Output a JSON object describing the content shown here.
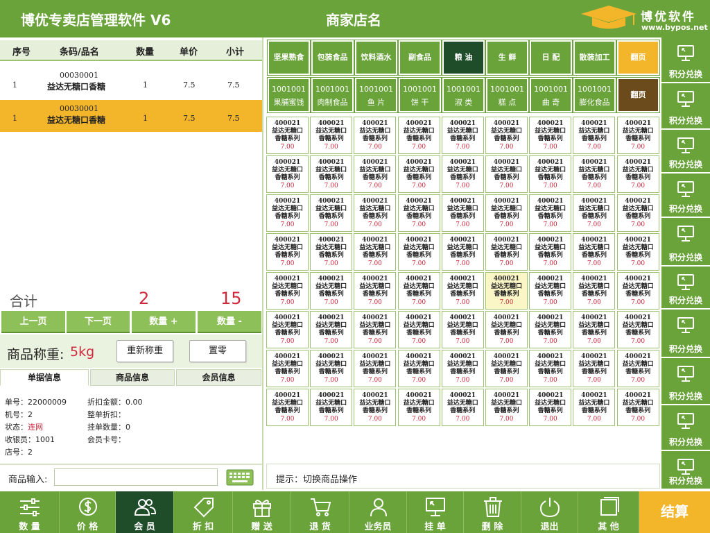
{
  "header": {
    "app_title": "博优专卖店管理软件 V6",
    "store_name": "商家店名",
    "logo_brand": "博优软件",
    "logo_url": "www.bypos.net"
  },
  "cart": {
    "columns": [
      "序号",
      "条码/品名",
      "数量",
      "单价",
      "小计"
    ],
    "rows": [
      {
        "index": "1",
        "barcode": "00030001",
        "name": "益达无糖口香糖",
        "qty": "1",
        "price": "7.5",
        "subtotal": "7.5"
      },
      {
        "index": "1",
        "barcode": "00030001",
        "name": "益达无糖口香糖",
        "qty": "1",
        "price": "7.5",
        "subtotal": "7.5"
      }
    ],
    "selected_row": 2,
    "total_label": "合计",
    "total_qty": "2",
    "total_amount": "15"
  },
  "cart_nav": {
    "prev_page": "上一页",
    "next_page": "下一页",
    "qty_plus": "数量 +",
    "qty_minus": "数量 -"
  },
  "weigh": {
    "label": "商品称重:",
    "value": "5kg",
    "reweigh": "重新称重",
    "zero": "置零"
  },
  "info_tabs": [
    "单据信息",
    "商品信息",
    "会员信息"
  ],
  "order_info": {
    "order_no": "单号：22000009",
    "machine_no": "机号：2",
    "status_label": "状态：",
    "status_value": "连网",
    "cashier": "收银员：1001",
    "shop_no": "店号：2",
    "discount_amount": "折扣金额：0.00",
    "whole_discount": "整单折扣：",
    "held_count": "挂单数量：0",
    "member_card": "会员卡号："
  },
  "goods_input": {
    "label": "商品输入:",
    "value": ""
  },
  "categories_row1": [
    "坚果熟食",
    "包装食品",
    "饮料酒水",
    "副食品",
    "粮 油",
    "生 鲜",
    "日 配",
    "散装加工",
    "翻页"
  ],
  "categories_row2": [
    {
      "code": "1001001",
      "name": "果脯蜜饯"
    },
    {
      "code": "1001001",
      "name": "肉制食品"
    },
    {
      "code": "1001001",
      "name": "鱼 片"
    },
    {
      "code": "1001001",
      "name": "饼 干"
    },
    {
      "code": "1001001",
      "name": "淑 类"
    },
    {
      "code": "1001001",
      "name": "糕 点"
    },
    {
      "code": "1001001",
      "name": "曲 奇"
    },
    {
      "code": "1001001",
      "name": "膨化食品"
    },
    {
      "code": "",
      "name": "翻页"
    }
  ],
  "product_item": {
    "code": "400021",
    "name_line1": "益达无糖口",
    "name_line2": "香糖系列",
    "price": "7.00"
  },
  "product_grid": {
    "rows": 8,
    "cols": 9,
    "highlighted": [
      4,
      5
    ]
  },
  "hint": "提示：切换商品操作",
  "right_buttons": [
    "积分兑换",
    "积分兑换",
    "积分兑换",
    "积分兑换",
    "积分兑换",
    "积分兑换",
    "积分兑换",
    "积分兑换",
    "积分兑换",
    "积分兑换"
  ],
  "bottom_buttons": [
    {
      "label": "数 量",
      "icon": "sliders-icon"
    },
    {
      "label": "价 格",
      "icon": "dollar-icon"
    },
    {
      "label": "会 员",
      "icon": "users-icon"
    },
    {
      "label": "折 扣",
      "icon": "tag-icon"
    },
    {
      "label": "赠 送",
      "icon": "gift-icon"
    },
    {
      "label": "退 货",
      "icon": "cart-icon"
    },
    {
      "label": "业务员",
      "icon": "user-icon"
    },
    {
      "label": "挂 单",
      "icon": "monitor-icon"
    },
    {
      "label": "删 除",
      "icon": "trash-icon"
    },
    {
      "label": "退出",
      "icon": "power-icon"
    },
    {
      "label": "其 他",
      "icon": "square-icon"
    }
  ],
  "active_bottom": 2,
  "checkout": "结算",
  "colors": {
    "primary_green": "#6aa33a",
    "dark_green": "#1f4d2a",
    "accent_yellow": "#f3b52a",
    "price_red": "#d0283c"
  }
}
